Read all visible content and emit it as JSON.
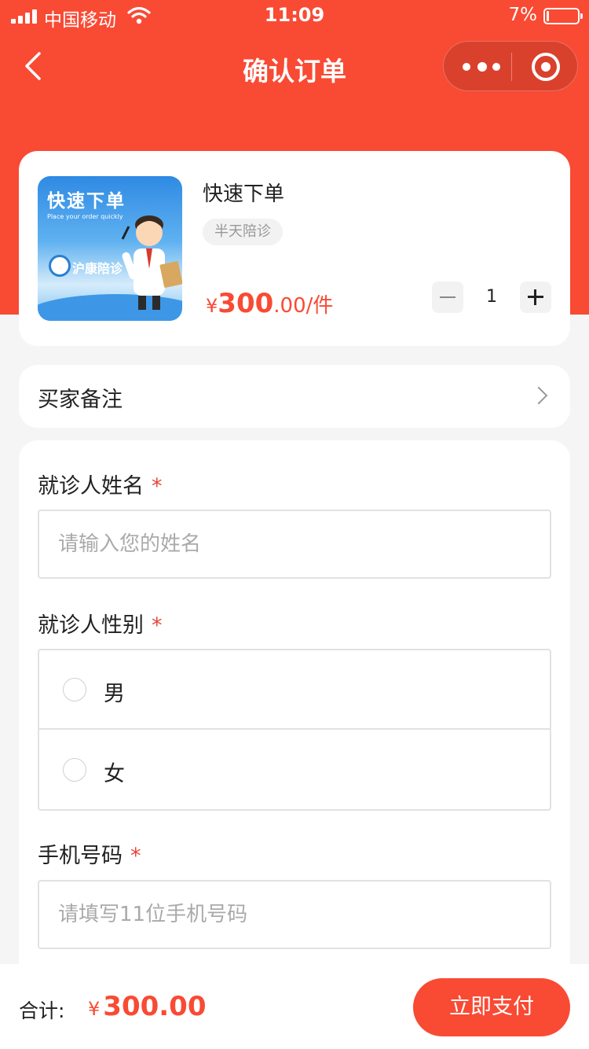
{
  "colors": {
    "brand": "#f94a34",
    "price": "#f94a34",
    "required": "#e9453a",
    "page_bg": "#f5f5f5"
  },
  "status_bar": {
    "carrier": "中国移动",
    "time": "11:09",
    "battery": "7%"
  },
  "nav": {
    "title": "确认订单",
    "back_icon": "chevron-left-icon",
    "more_icon": "more-dots-icon",
    "close_icon": "target-circle-icon"
  },
  "product": {
    "image": {
      "title": "快速下单",
      "subtitle": "Place your order quickly",
      "brand": "沪康陪诊"
    },
    "name": "快速下单",
    "tag": "半天陪诊",
    "price_currency": "¥",
    "price_integer": "300",
    "price_decimal": ".00",
    "price_unit": "/件",
    "quantity": "1"
  },
  "remark": {
    "label": "买家备注"
  },
  "form": {
    "name": {
      "label": "就诊人姓名",
      "required_mark": "*",
      "placeholder": "请输入您的姓名",
      "value": ""
    },
    "gender": {
      "label": "就诊人性别",
      "required_mark": "*",
      "options": [
        "男",
        "女"
      ],
      "selected": null
    },
    "phone": {
      "label": "手机号码",
      "required_mark": "*",
      "placeholder": "请填写11位手机号码",
      "value": ""
    }
  },
  "footer": {
    "total_label": "合计:",
    "currency": "¥",
    "total": "300.00",
    "pay_button": "立即支付"
  }
}
